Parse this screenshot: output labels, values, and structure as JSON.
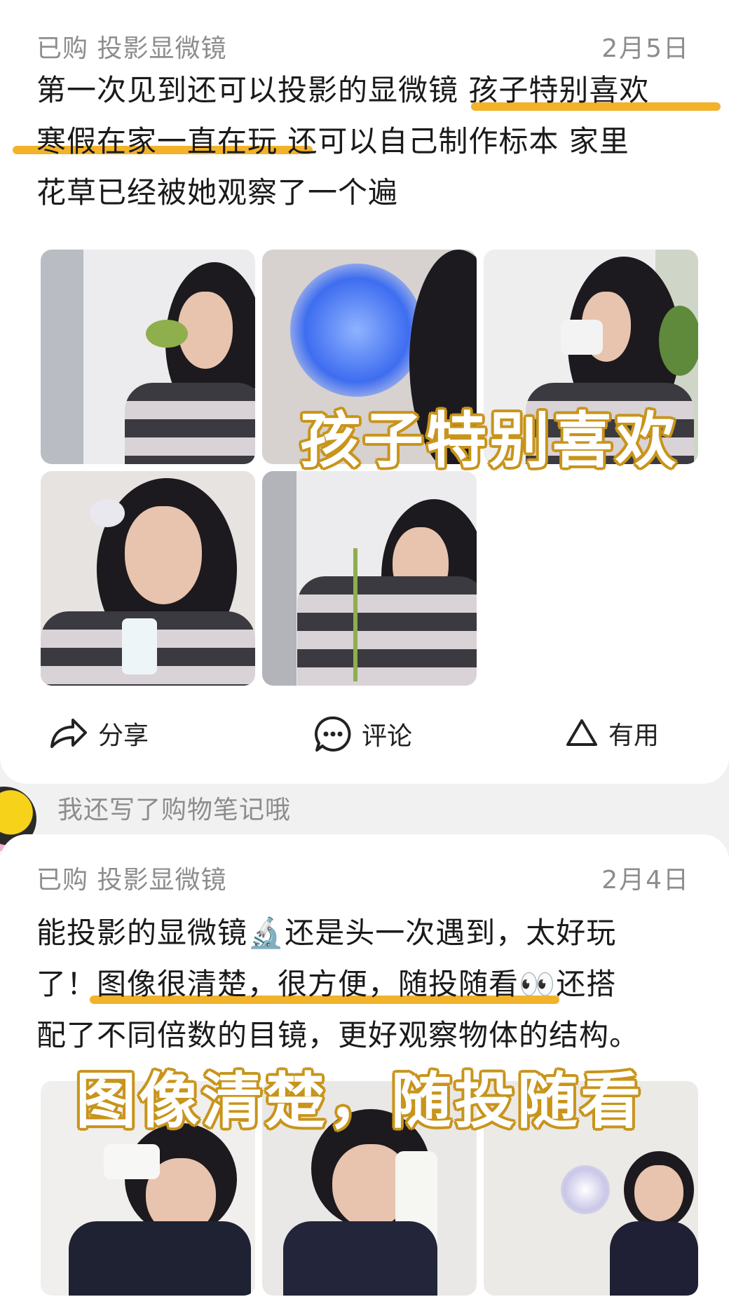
{
  "review1": {
    "tag": "已购 投影显微镜",
    "date": "2月5日",
    "lines": [
      "第一次见到还可以投影的显微镜 孩子特别喜欢",
      "寒假在家一直在玩 还可以自己制作标本 家里",
      "花草已经被她观察了一个遍"
    ],
    "overlay": "孩子特别喜欢"
  },
  "actions": {
    "share": "分享",
    "comment": "评论",
    "useful": "有用"
  },
  "note_row": {
    "text": "我还写了购物笔记哦"
  },
  "review2": {
    "tag": "已购 投影显微镜",
    "date": "2月4日",
    "lines": [
      "能投影的显微镜🔬还是头一次遇到，太好玩",
      "了！图像很清楚，很方便，随投随看👀还搭",
      "配了不同倍数的目镜，更好观察物体的结构。"
    ],
    "overlay": "图像清楚，随投随看"
  },
  "colors": {
    "highlight": "#f2b229",
    "meta": "#8d8d8d",
    "text": "#1a1a1a"
  },
  "icons": [
    "share-icon",
    "comment-icon",
    "useful-icon",
    "microscope-emoji",
    "eyes-emoji"
  ]
}
